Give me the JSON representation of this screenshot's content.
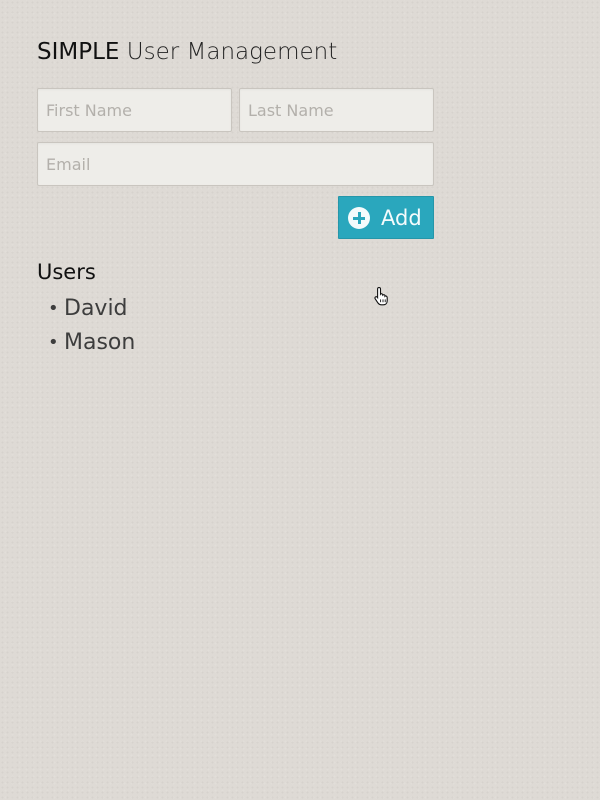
{
  "app": {
    "title_brand": "SIMPLE",
    "title_rest": "User Management"
  },
  "form": {
    "first_name": {
      "placeholder": "First Name",
      "value": ""
    },
    "last_name": {
      "placeholder": "Last Name",
      "value": ""
    },
    "email": {
      "placeholder": "Email",
      "value": ""
    },
    "add_button": {
      "label": "Add",
      "icon": "plus-circle-icon"
    }
  },
  "users": {
    "heading": "Users",
    "bullet": "•",
    "items": [
      {
        "name": "David"
      },
      {
        "name": "Mason"
      }
    ]
  },
  "colors": {
    "accent": "#2aa7bd",
    "background": "#dedad5",
    "input_background": "#eeede9"
  }
}
